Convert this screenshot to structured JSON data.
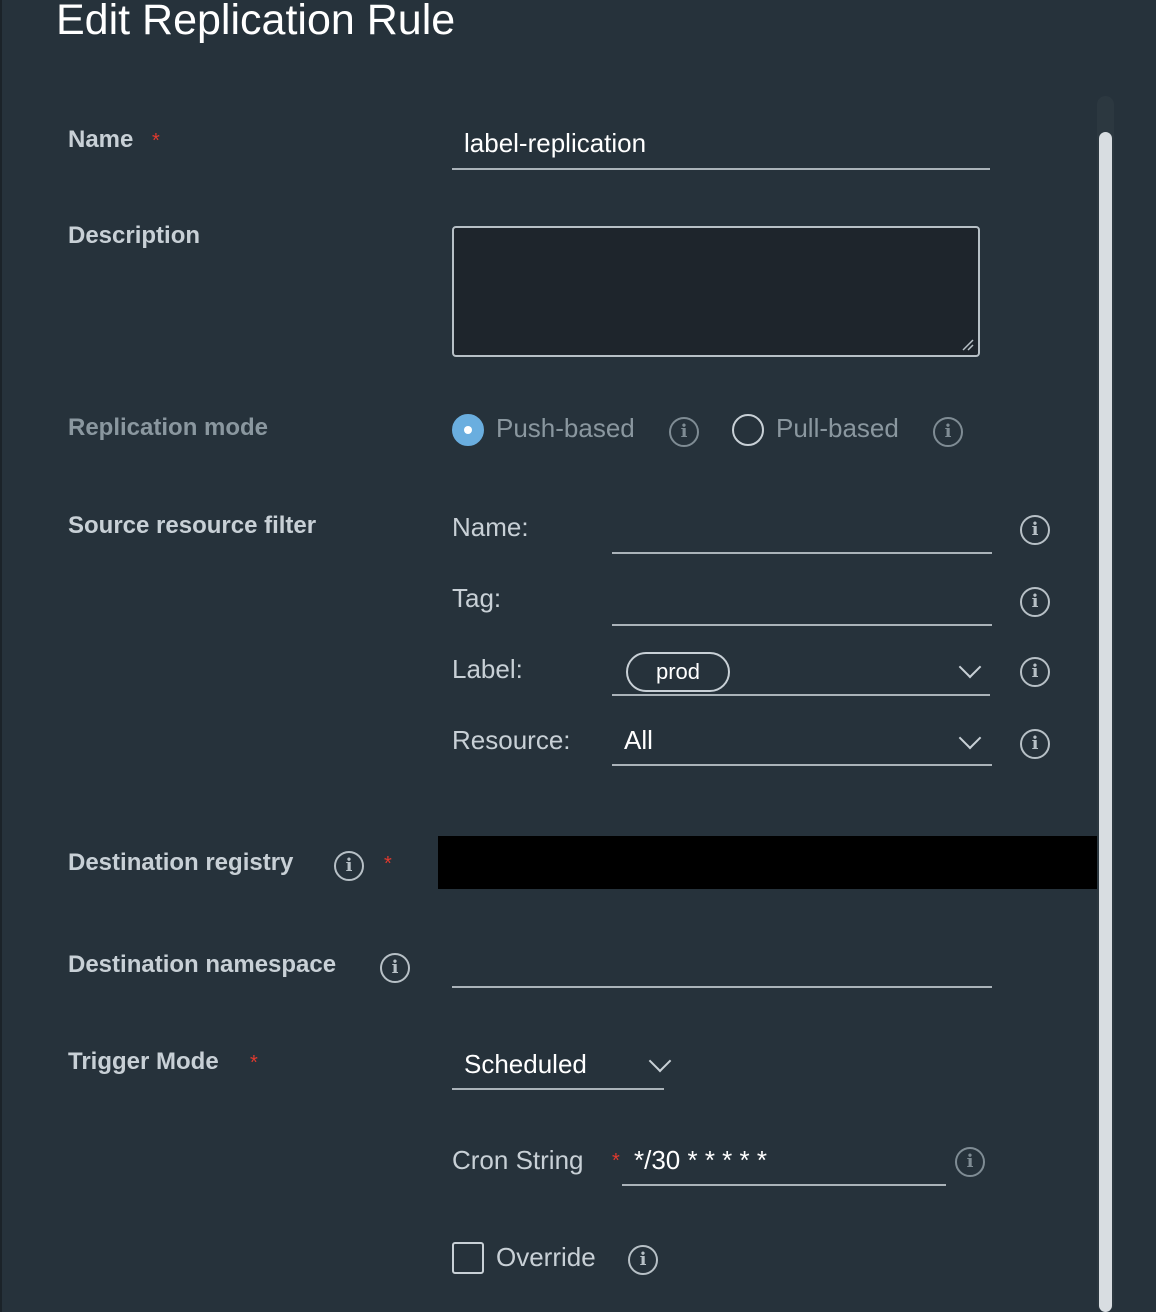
{
  "dialog": {
    "title": "Edit Replication Rule"
  },
  "form": {
    "name": {
      "label": "Name",
      "required": "*",
      "value": "label-replication"
    },
    "description": {
      "label": "Description",
      "value": ""
    },
    "replication_mode": {
      "label": "Replication mode",
      "options": [
        {
          "label": "Push-based",
          "selected": true
        },
        {
          "label": "Pull-based",
          "selected": false
        }
      ]
    },
    "source_filter": {
      "label": "Source resource filter",
      "name_label": "Name:",
      "name_value": "",
      "tag_label": "Tag:",
      "tag_value": "",
      "label_label": "Label:",
      "label_chip": "prod",
      "resource_label": "Resource:",
      "resource_value": "All"
    },
    "destination_registry": {
      "label": "Destination registry",
      "required": "*"
    },
    "destination_namespace": {
      "label": "Destination namespace",
      "value": ""
    },
    "trigger_mode": {
      "label": "Trigger Mode",
      "required": "*",
      "value": "Scheduled"
    },
    "cron": {
      "label": "Cron String",
      "required": "*",
      "value": "*/30 * * * * *"
    },
    "override": {
      "label": "Override",
      "checked": false
    }
  },
  "icons": {
    "info": "info-icon",
    "chevron": "chevron-down-icon",
    "resize": "resize-grip-icon"
  },
  "colors": {
    "background": "#26323b",
    "accent": "#6aaedf",
    "required": "#e23a2e",
    "field": "#1e252c"
  }
}
